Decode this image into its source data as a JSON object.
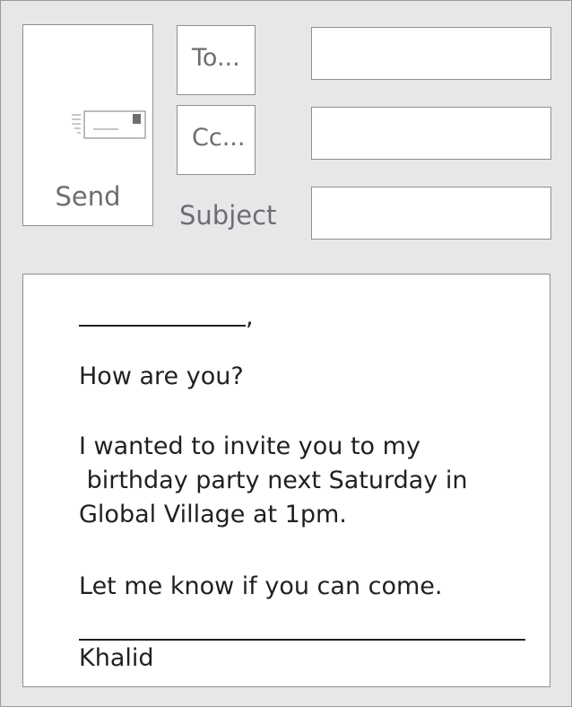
{
  "toolbar": {
    "send_label": "Send",
    "to_label": "To...",
    "cc_label": "Cc...",
    "subject_label": "Subject"
  },
  "fields": {
    "to_value": "",
    "cc_value": "",
    "subject_value": ""
  },
  "message": {
    "greeting_punctuation": ",",
    "line_1": "How are you?",
    "line_2": "I wanted to invite you to my",
    "line_3": " birthday party next Saturday in",
    "line_4": "Global Village at 1pm.",
    "line_5": "Let me know if you can come.",
    "signature": "Khalid"
  },
  "icons": {
    "send": "envelope-icon"
  },
  "colors": {
    "background": "#e6e7e8",
    "label_gray": "#6d6e71",
    "text": "#231f20"
  }
}
